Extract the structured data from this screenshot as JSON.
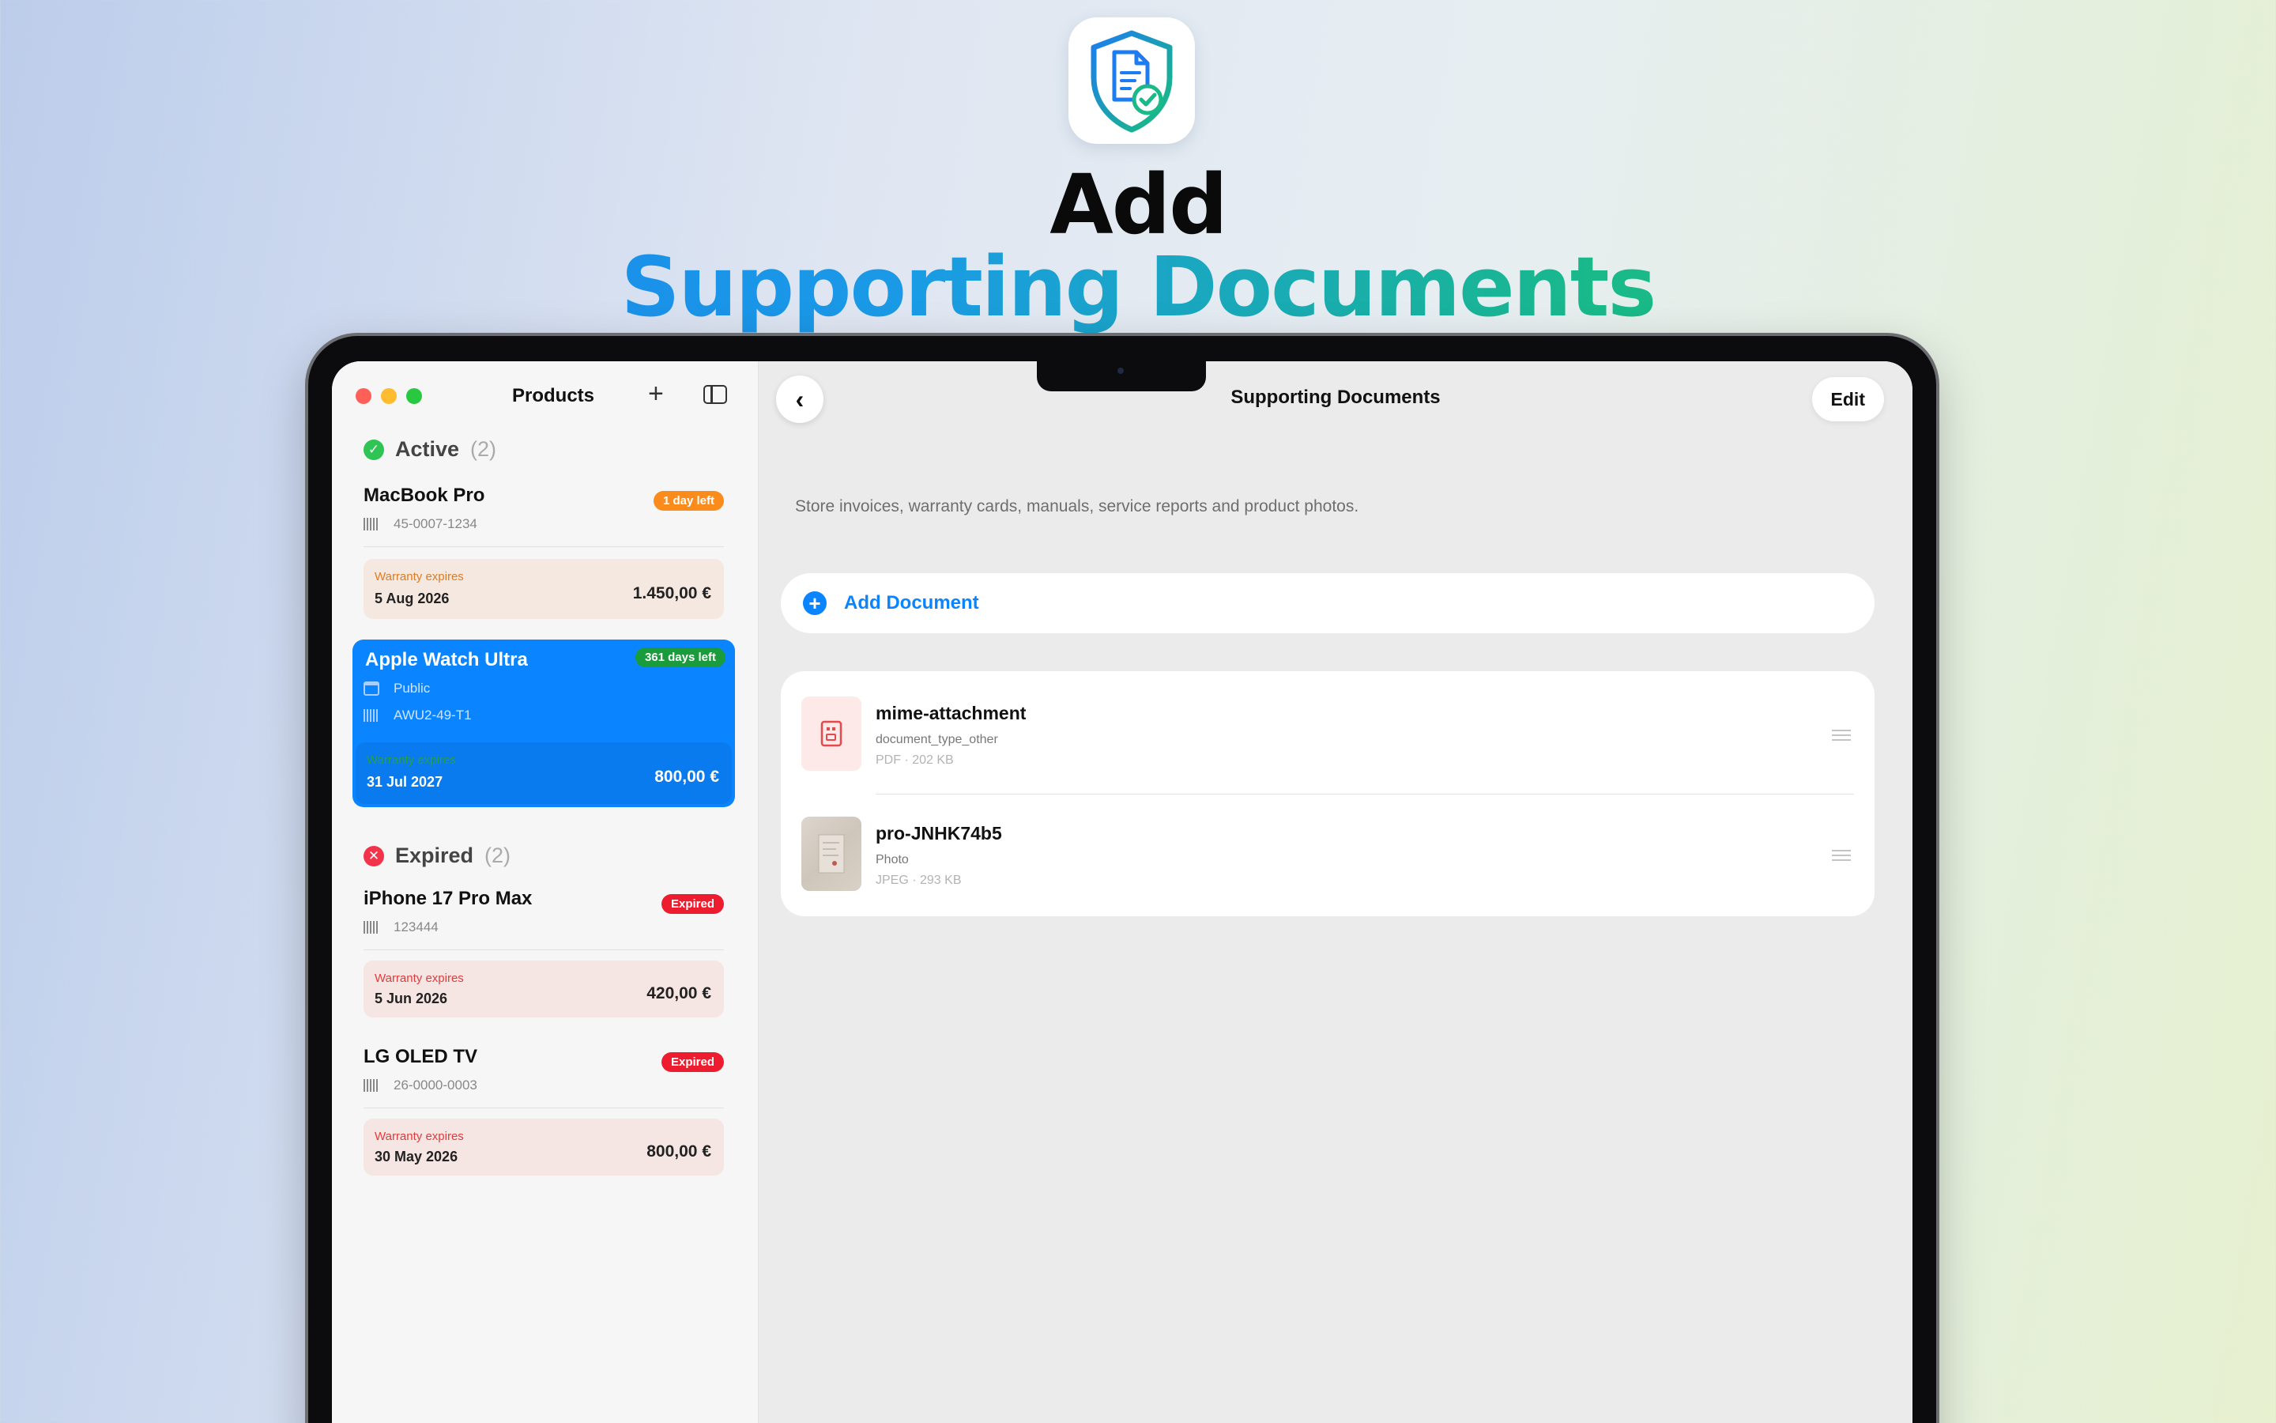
{
  "hero": {
    "line1": "Add",
    "line2": "Supporting Documents",
    "app_icon": "shield-document-check-icon"
  },
  "sidebar": {
    "title": "Products",
    "active_section": {
      "label": "Active",
      "count": "(2)"
    },
    "expired_section": {
      "label": "Expired",
      "count": "(2)"
    },
    "products": [
      {
        "name": "MacBook Pro",
        "badge": "1 day left",
        "code": "45-0007-1234",
        "warranty_label": "Warranty expires",
        "warranty_date": "5 Aug 2026",
        "price": "1.450,00 €"
      },
      {
        "name": "Apple Watch Ultra",
        "badge": "361 days left",
        "visibility": "Public",
        "code": "AWU2-49-T1",
        "warranty_label": "Warranty expires",
        "warranty_date": "31 Jul 2027",
        "price": "800,00 €"
      },
      {
        "name": "iPhone 17 Pro Max",
        "badge": "Expired",
        "code": "123444",
        "warranty_label": "Warranty expires",
        "warranty_date": "5 Jun 2026",
        "price": "420,00 €"
      },
      {
        "name": "LG OLED TV",
        "badge": "Expired",
        "code": "26-0000-0003",
        "warranty_label": "Warranty expires",
        "warranty_date": "30 May 2026",
        "price": "800,00 €"
      }
    ]
  },
  "detail": {
    "title": "Supporting Documents",
    "edit_label": "Edit",
    "helper_text": "Store invoices, warranty cards, manuals, service reports and product photos.",
    "add_document_label": "Add Document",
    "documents": [
      {
        "name": "mime-attachment",
        "type": "document_type_other",
        "meta": "PDF · 202 KB"
      },
      {
        "name": "pro-JNHK74b5",
        "type": "Photo",
        "meta": "JPEG · 293 KB"
      }
    ]
  },
  "colors": {
    "accent": "#0a84ff",
    "active_green": "#2fc453",
    "expired_red": "#ed1c2e",
    "warning_orange": "#fb8c1c"
  }
}
